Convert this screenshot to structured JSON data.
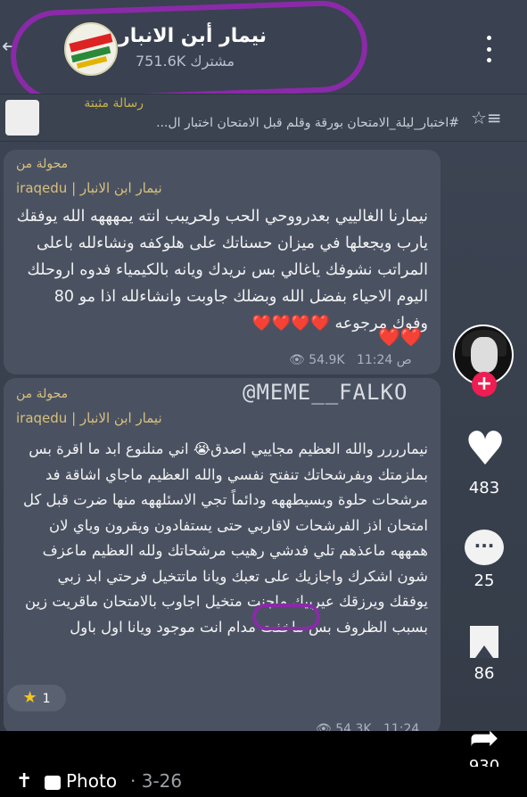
{
  "header": {
    "channel_name": "نيمار أبن الانبار",
    "subscribers": "751.6K مشترك",
    "back_glyph": "←",
    "menu_icon": "more-vertical-icon"
  },
  "pinned": {
    "title": "رسالة مثبتة",
    "text": "#اختبار_ليلة_الامتحان   بورقة وقلم قبل الامتحان اختبار ال..."
  },
  "messages": [
    {
      "forwarded_label": "محولة من",
      "source": "iraqedu | نيمار ابن الانبار",
      "text": "نيمارنا الغالييي بعدرووحي الحب ولحريبب انته يمهههه الله يوفقك يارب ويجعلها في ميزان حسناتك على هلوكفه ونشاءلله باعلى المراتب نشوفك ياغالي بس نريدك ويانه بالكيمياء فدوه اروحلك اليوم الاحياء بفضل الله وبضلك جاوبت وانشاءلله اذا مو 80 وفوك مرجوعه",
      "hearts_inline": "❤️❤️❤️❤️",
      "hearts_row2": "❤️❤️",
      "views": "54.9K",
      "time": "11:24 ص"
    },
    {
      "forwarded_label": "محولة من",
      "source": "iraqedu | نيمار ابن الانبار",
      "text": "نيمارررر والله العظيم مجاييي اصدق😭 اني منلنوع ابد ما اقرة بس بملزمتك وبفرشحاتك تنفتح نفسي والله العظيم ماجاي اشاقة فد مرشحات حلوة وبسيطههه ودائماً تجي الاسئلههه منها ضرت قبل كل امتحان اذز الفرشحات لاقاربي حتى يستفادون ويقرون وياي لان همههه ماعذهم تلي فدشي رهيب مرشحاتك ولله العظيم ماعزف شون اشكرك واجازيك على تعبك ويانا ماتتخيل فرحتي ابد زبي يوفقك ويرزقك عيربيك ماجنت متخيل اجاوب بالامتحان ماقريت زين بسبب الظروف بس ماخفت مدام انت موجود ويانا اول باول",
      "reaction_count": "1",
      "views": "54.3K",
      "time": "11:24"
    }
  ],
  "watermark": "@MEME__FALKO",
  "rail": {
    "likes": "483",
    "comments": "25",
    "saves": "86",
    "shares": "930"
  },
  "bottom": {
    "type_label": "Photo",
    "date": "· 3-26"
  },
  "colors": {
    "highlight": "#8a2aa8",
    "tiktok_red": "#ee1d52",
    "bubble": "#4a5262",
    "forward_gold": "#d9c07a"
  }
}
